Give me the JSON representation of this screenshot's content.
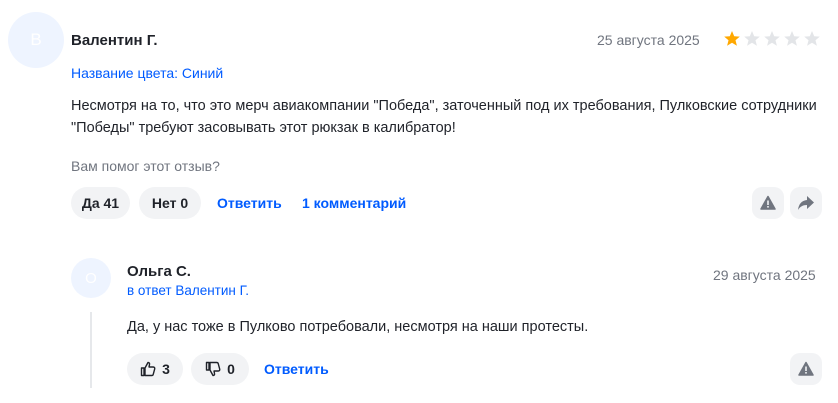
{
  "review": {
    "avatar_letter": "В",
    "author": "Валентин Г.",
    "date": "25 августа 2025",
    "rating": 1,
    "rating_max": 5,
    "color_label": "Название цвета: Синий",
    "text_line1": "Несмотря на то, что это мерч авиакомпании \"Победа\", заточенный под их требования, Пулковские сотрудники",
    "text_line2": "\"Победы\" требуют засовывать этот рюкзак в калибратор!",
    "helpful_question": "Вам помог этот отзыв?",
    "yes_label": "Да 41",
    "no_label": "Нет 0",
    "reply_label": "Ответить",
    "comments_label": "1 комментарий"
  },
  "reply": {
    "avatar_letter": "О",
    "author": "Ольга С.",
    "in_reply_to": "в ответ Валентин Г.",
    "date": "29 августа 2025",
    "text": "Да, у нас тоже в Пулково потребовали, несмотря на наши протесты.",
    "likes": "3",
    "dislikes": "0",
    "reply_label": "Ответить"
  },
  "colors": {
    "accent": "#005bff",
    "star_filled": "#ffa800",
    "star_empty": "#e3e5e8",
    "pill_bg": "#f2f3f5"
  },
  "icons": [
    "warning-icon",
    "share-arrow-icon",
    "thumb-up-icon",
    "thumb-down-icon",
    "star-icon"
  ]
}
